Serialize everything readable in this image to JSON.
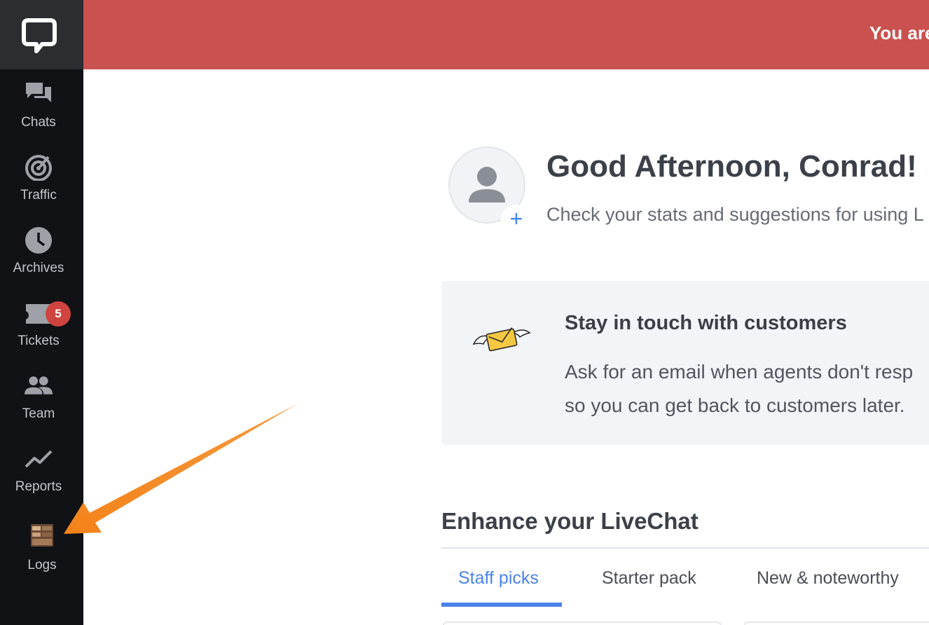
{
  "sidebar": {
    "items": [
      {
        "label": "Chats",
        "icon": "chats-icon"
      },
      {
        "label": "Traffic",
        "icon": "traffic-icon"
      },
      {
        "label": "Archives",
        "icon": "clock-icon"
      },
      {
        "label": "Tickets",
        "icon": "ticket-icon",
        "badge": "5"
      },
      {
        "label": "Team",
        "icon": "team-icon"
      },
      {
        "label": "Reports",
        "icon": "reports-icon"
      },
      {
        "label": "Logs",
        "icon": "logs-icon"
      }
    ]
  },
  "banner": {
    "text": "You are",
    "color": "#c9514f"
  },
  "greeting": {
    "title": "Good Afternoon, Conrad!",
    "subtitle": "Check your stats and suggestions for using L"
  },
  "suggestion": {
    "title": "Stay in touch with customers",
    "line1": "Ask for an email when agents don't resp",
    "line2": "so you can get back to customers later."
  },
  "enhance": {
    "title": "Enhance your LiveChat",
    "tabs": [
      "Staff picks",
      "Starter pack",
      "New & noteworthy"
    ]
  },
  "colors": {
    "accent": "#4a83e8",
    "badge": "#d0443f",
    "arrow": "#f07f1a"
  }
}
